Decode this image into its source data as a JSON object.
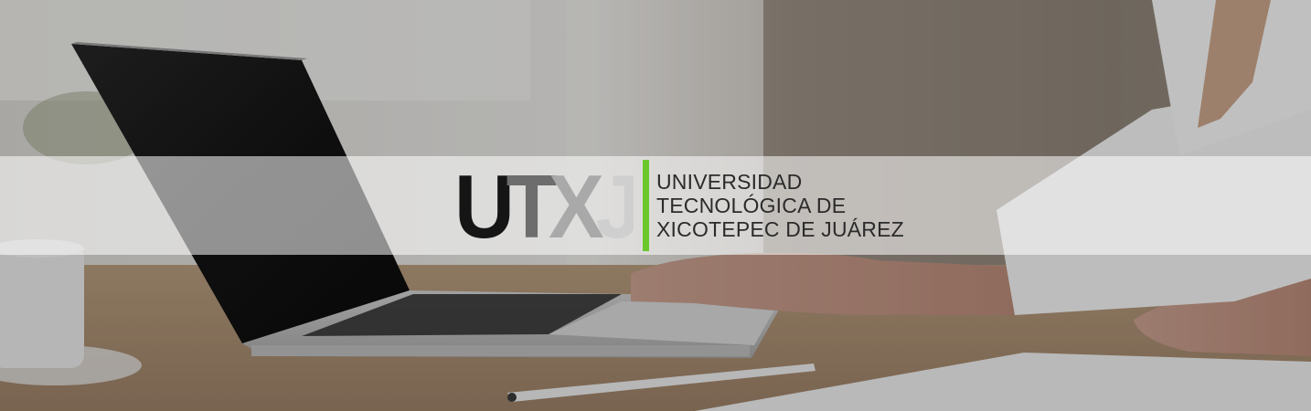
{
  "banner": {
    "logo": {
      "monogram": "UTXJ",
      "name_lines": [
        "UNIVERSIDAD",
        "TECNOLÓGICA DE",
        "XICOTEPEC DE JUÁREZ"
      ],
      "colors": {
        "accent_green": "#6cc72b",
        "letter_dark": "#151515",
        "letter_mid": "#6d6d6d",
        "letter_light": "#a9a9a9",
        "text": "#2b2b2b"
      }
    },
    "photo_subject": "person typing on laptop at desk"
  }
}
